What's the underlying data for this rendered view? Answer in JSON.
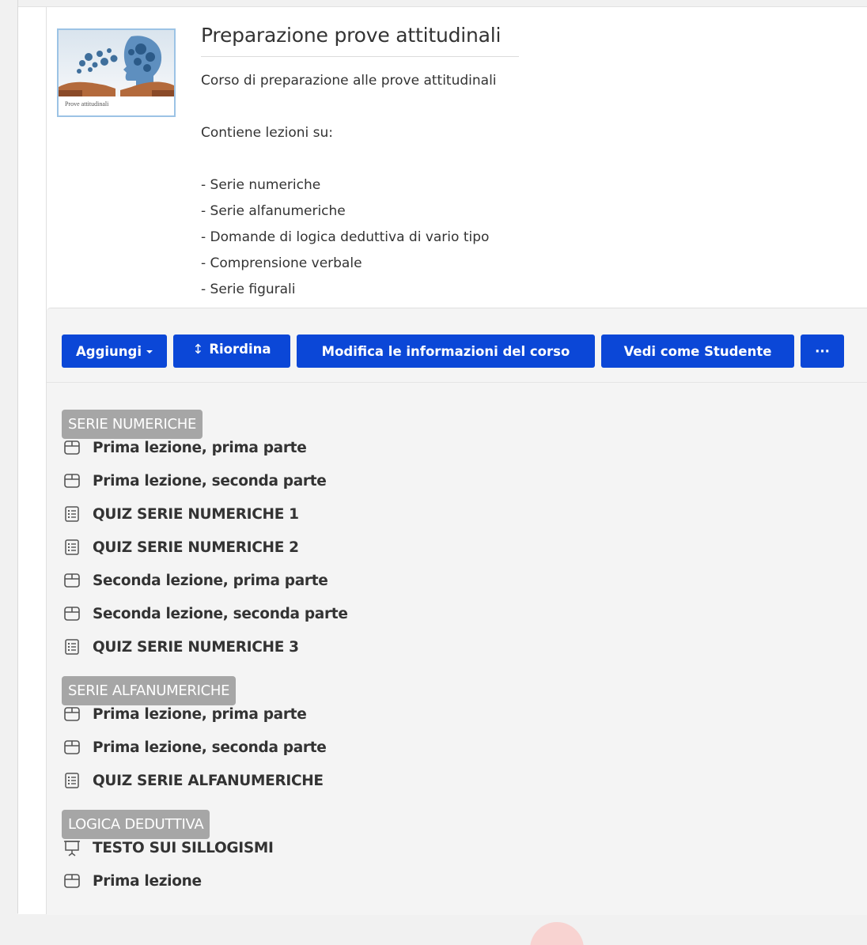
{
  "course": {
    "thumbnail_caption": "Prove attitudinali",
    "title": "Preparazione prove attitudinali",
    "description": [
      "Corso di preparazione alle prove attitudinali",
      "",
      "Contiene lezioni su:",
      "",
      "- Serie numeriche",
      "- Serie alfanumeriche",
      "- Domande di logica deduttiva di vario tipo",
      "- Comprensione verbale",
      "- Serie figurali"
    ]
  },
  "toolbar": {
    "add_label": "Aggiungi",
    "reorder_label": "Riordina",
    "edit_label": "Modifica le informazioni del corso",
    "student_label": "Vedi come Studente",
    "more_label": "···"
  },
  "sections": [
    {
      "title": "SERIE NUMERICHE",
      "items": [
        {
          "icon": "lesson-icon",
          "label": "Prima lezione, prima parte"
        },
        {
          "icon": "lesson-icon",
          "label": "Prima lezione, seconda parte"
        },
        {
          "icon": "quiz-icon",
          "label": "QUIZ SERIE NUMERICHE 1"
        },
        {
          "icon": "quiz-icon",
          "label": "QUIZ SERIE NUMERICHE 2"
        },
        {
          "icon": "lesson-icon",
          "label": "Seconda lezione, prima parte"
        },
        {
          "icon": "lesson-icon",
          "label": "Seconda lezione, seconda parte"
        },
        {
          "icon": "quiz-icon",
          "label": "QUIZ SERIE NUMERICHE 3"
        }
      ]
    },
    {
      "title": "SERIE ALFANUMERICHE",
      "items": [
        {
          "icon": "lesson-icon",
          "label": "Prima lezione, prima parte"
        },
        {
          "icon": "lesson-icon",
          "label": "Prima lezione, seconda parte"
        },
        {
          "icon": "quiz-icon",
          "label": "QUIZ SERIE ALFANUMERICHE"
        }
      ]
    },
    {
      "title": "LOGICA DEDUTTIVA",
      "items": [
        {
          "icon": "presentation-icon",
          "label": "TESTO SUI SILLOGISMI"
        },
        {
          "icon": "lesson-icon",
          "label": "Prima lezione"
        }
      ]
    }
  ],
  "colors": {
    "primary_button": "#0b47d7",
    "section_badge": "#a6a6a6",
    "thumbnail_border": "#9cc3e5"
  }
}
